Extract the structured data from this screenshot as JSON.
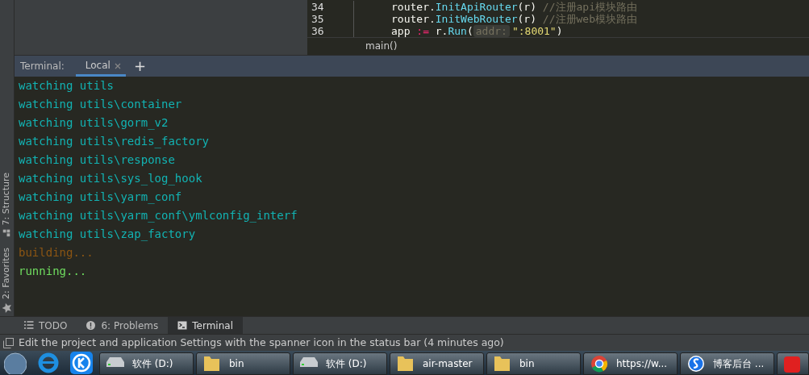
{
  "editor": {
    "lines": [
      {
        "number": "34",
        "parts": [
          {
            "kind": "plain",
            "text": "router."
          },
          {
            "kind": "call",
            "text": "InitApiRouter"
          },
          {
            "kind": "plain",
            "text": "(r) "
          },
          {
            "kind": "comment",
            "text": "//注册api模块路由"
          }
        ]
      },
      {
        "number": "35",
        "parts": [
          {
            "kind": "plain",
            "text": "router."
          },
          {
            "kind": "call",
            "text": "InitWebRouter"
          },
          {
            "kind": "plain",
            "text": "(r) "
          },
          {
            "kind": "comment",
            "text": "//注册web模块路由"
          }
        ]
      },
      {
        "number": "36",
        "parts": [
          {
            "kind": "plain",
            "text": "app "
          },
          {
            "kind": "operator",
            "text": ":="
          },
          {
            "kind": "plain",
            "text": " r."
          },
          {
            "kind": "call",
            "text": "Run"
          },
          {
            "kind": "plain",
            "text": "("
          },
          {
            "kind": "hint",
            "text": "addr:"
          },
          {
            "kind": "string",
            "text": "\":8001\""
          },
          {
            "kind": "plain",
            "text": ")"
          }
        ]
      }
    ],
    "breadcrumb": "main()"
  },
  "terminal": {
    "label": "Terminal:",
    "tabs": [
      {
        "label": "Local",
        "selected": true
      }
    ],
    "add_label": "+",
    "output": [
      {
        "kind": "watch",
        "text": "watching utils"
      },
      {
        "kind": "watch",
        "text": "watching utils\\container"
      },
      {
        "kind": "watch",
        "text": "watching utils\\gorm_v2"
      },
      {
        "kind": "watch",
        "text": "watching utils\\redis_factory"
      },
      {
        "kind": "watch",
        "text": "watching utils\\response"
      },
      {
        "kind": "watch",
        "text": "watching utils\\sys_log_hook"
      },
      {
        "kind": "watch",
        "text": "watching utils\\yarm_conf"
      },
      {
        "kind": "watch",
        "text": "watching utils\\yarm_conf\\ymlconfig_interf"
      },
      {
        "kind": "watch",
        "text": "watching utils\\zap_factory"
      },
      {
        "kind": "build",
        "text": "building..."
      },
      {
        "kind": "run",
        "text": "running..."
      }
    ]
  },
  "side_tools": [
    {
      "kind": "structure",
      "label": "7: Structure"
    },
    {
      "kind": "favorites",
      "label": "2: Favorites"
    }
  ],
  "tool_tabs": [
    {
      "kind": "todo",
      "label": "TODO",
      "selected": false
    },
    {
      "kind": "problems",
      "label": "6: Problems",
      "selected": false
    },
    {
      "kind": "terminal",
      "label": "Terminal",
      "selected": true
    }
  ],
  "status_bar": "Edit the project and application Settings with the spanner icon in the status bar (4 minutes ago)",
  "taskbar": {
    "pinned": [
      {
        "kind": "start"
      },
      {
        "kind": "browser"
      },
      {
        "kind": "k-app"
      }
    ],
    "buttons": [
      {
        "kind": "drive",
        "label": "软件 (D:)"
      },
      {
        "kind": "folder",
        "label": "bin"
      },
      {
        "kind": "drive",
        "label": "软件 (D:)"
      },
      {
        "kind": "folder",
        "label": "air-master"
      },
      {
        "kind": "folder",
        "label": "bin"
      },
      {
        "kind": "chrome",
        "label": "https://w..."
      },
      {
        "kind": "sogou",
        "label": "博客后台 ..."
      },
      {
        "kind": "red-app"
      }
    ]
  }
}
